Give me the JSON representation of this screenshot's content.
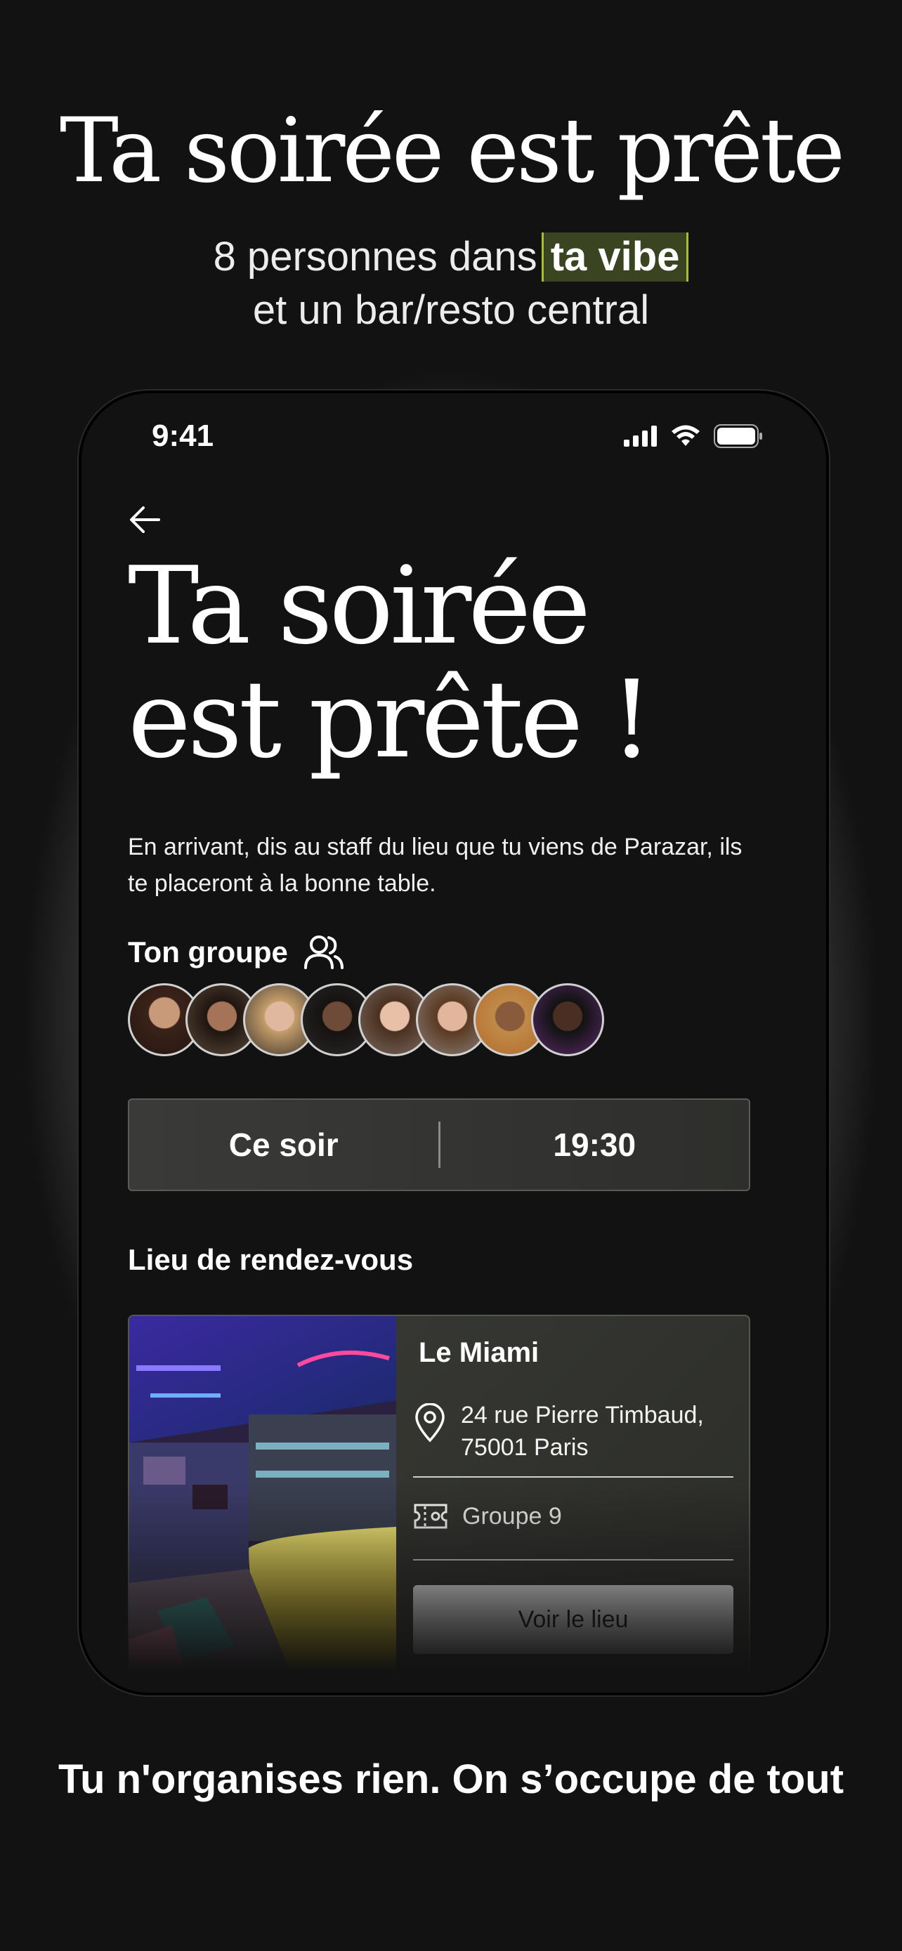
{
  "hero": {
    "title": "Ta soirée est prête",
    "subtitle_prefix": "8 personnes dans",
    "subtitle_highlight": "ta vibe",
    "subtitle_line2": "et un bar/resto central"
  },
  "status_bar": {
    "time": "9:41"
  },
  "screen": {
    "title": "Ta soirée est prête !",
    "intro": "En arrivant, dis au staff du lieu que tu viens de Parazar, ils te placeront à la bonne table.",
    "group_label": "Ton groupe",
    "avatars": [
      "avatar-1",
      "avatar-2",
      "avatar-3",
      "avatar-4",
      "avatar-5",
      "avatar-6",
      "avatar-7",
      "avatar-8"
    ],
    "date": {
      "day": "Ce soir",
      "time": "19:30"
    },
    "venue_section_label": "Lieu de rendez-vous",
    "venue": {
      "name": "Le Miami",
      "address": "24 rue Pierre Timbaud, 75001 Paris",
      "group": "Groupe 9",
      "button_label": "Voir le lieu"
    }
  },
  "tagline": "Tu n'organises rien. On s’occupe de tout",
  "colors": {
    "highlight_bg": "#3b4420",
    "highlight_border": "#a5c02c",
    "background": "#121212"
  }
}
